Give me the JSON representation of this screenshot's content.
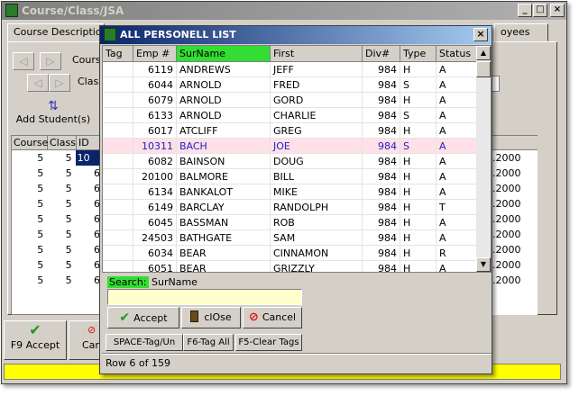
{
  "main_window": {
    "title": "Course/Class/JSA",
    "tabs": [
      "Course Description",
      "oyees"
    ],
    "labels": {
      "course": "Course",
      "class": "Class"
    },
    "add_student": "Add Student(s)",
    "grid_headers": [
      "Course",
      "Class",
      "ID"
    ],
    "grid_rows": [
      [
        "5",
        "5",
        "10"
      ],
      [
        "5",
        "5",
        "6"
      ],
      [
        "5",
        "5",
        "6"
      ],
      [
        "5",
        "5",
        "6"
      ],
      [
        "5",
        "5",
        "6"
      ],
      [
        "5",
        "5",
        "6"
      ],
      [
        "5",
        "5",
        "6"
      ],
      [
        "5",
        "5",
        "6"
      ],
      [
        "5",
        "5",
        "6"
      ]
    ],
    "right_values": [
      ".2000",
      ".2000",
      ".2000",
      ".2000",
      ".2000",
      ".2000",
      ".2000",
      ".2000",
      ".2000"
    ],
    "f9_accept": "F9 Accept",
    "cancel_partial": "Car"
  },
  "dialog": {
    "title": "ALL PERSONELL LIST",
    "columns": [
      "Tag",
      "Emp #",
      "SurName",
      "First",
      "Div#",
      "Type",
      "Status"
    ],
    "active_column": "SurName",
    "rows": [
      {
        "tag": "",
        "emp": "6119",
        "surname": "ANDREWS",
        "first": "JEFF",
        "div": "984",
        "type": "H",
        "status": "A"
      },
      {
        "tag": "",
        "emp": "6044",
        "surname": "ARNOLD",
        "first": "FRED",
        "div": "984",
        "type": "S",
        "status": "A"
      },
      {
        "tag": "",
        "emp": "6079",
        "surname": "ARNOLD",
        "first": "GORD",
        "div": "984",
        "type": "H",
        "status": "A"
      },
      {
        "tag": "",
        "emp": "6133",
        "surname": "ARNOLD",
        "first": "CHARLIE",
        "div": "984",
        "type": "S",
        "status": "A"
      },
      {
        "tag": "",
        "emp": "6017",
        "surname": "ATCLIFF",
        "first": "GREG",
        "div": "984",
        "type": "H",
        "status": "A"
      },
      {
        "tag": "",
        "emp": "10311",
        "surname": "BACH",
        "first": "JOE",
        "div": "984",
        "type": "S",
        "status": "A"
      },
      {
        "tag": "",
        "emp": "6082",
        "surname": "BAINSON",
        "first": "DOUG",
        "div": "984",
        "type": "H",
        "status": "A"
      },
      {
        "tag": "",
        "emp": "20100",
        "surname": "BALMORE",
        "first": "BILL",
        "div": "984",
        "type": "H",
        "status": "A"
      },
      {
        "tag": "",
        "emp": "6134",
        "surname": "BANKALOT",
        "first": "MIKE",
        "div": "984",
        "type": "H",
        "status": "A"
      },
      {
        "tag": "",
        "emp": "6149",
        "surname": "BARCLAY",
        "first": "RANDOLPH",
        "div": "984",
        "type": "H",
        "status": "T"
      },
      {
        "tag": "",
        "emp": "6045",
        "surname": "BASSMAN",
        "first": "ROB",
        "div": "984",
        "type": "H",
        "status": "A"
      },
      {
        "tag": "",
        "emp": "24503",
        "surname": "BATHGATE",
        "first": "SAM",
        "div": "984",
        "type": "H",
        "status": "A"
      },
      {
        "tag": "",
        "emp": "6034",
        "surname": "BEAR",
        "first": "CINNAMON",
        "div": "984",
        "type": "H",
        "status": "R"
      },
      {
        "tag": "",
        "emp": "6051",
        "surname": "BEAR",
        "first": "GRIZZLY",
        "div": "984",
        "type": "H",
        "status": "A"
      }
    ],
    "selected_index": 5,
    "search_label": "Search:",
    "search_field": "SurName",
    "search_value": "",
    "buttons": {
      "accept": "Accept",
      "close": "clOse",
      "cancel": "Cancel"
    },
    "shortcut_buttons": [
      "SPACE-Tag/Un",
      "F6-Tag All",
      "F5-Clear Tags"
    ],
    "status": "Row   6 of 159"
  }
}
